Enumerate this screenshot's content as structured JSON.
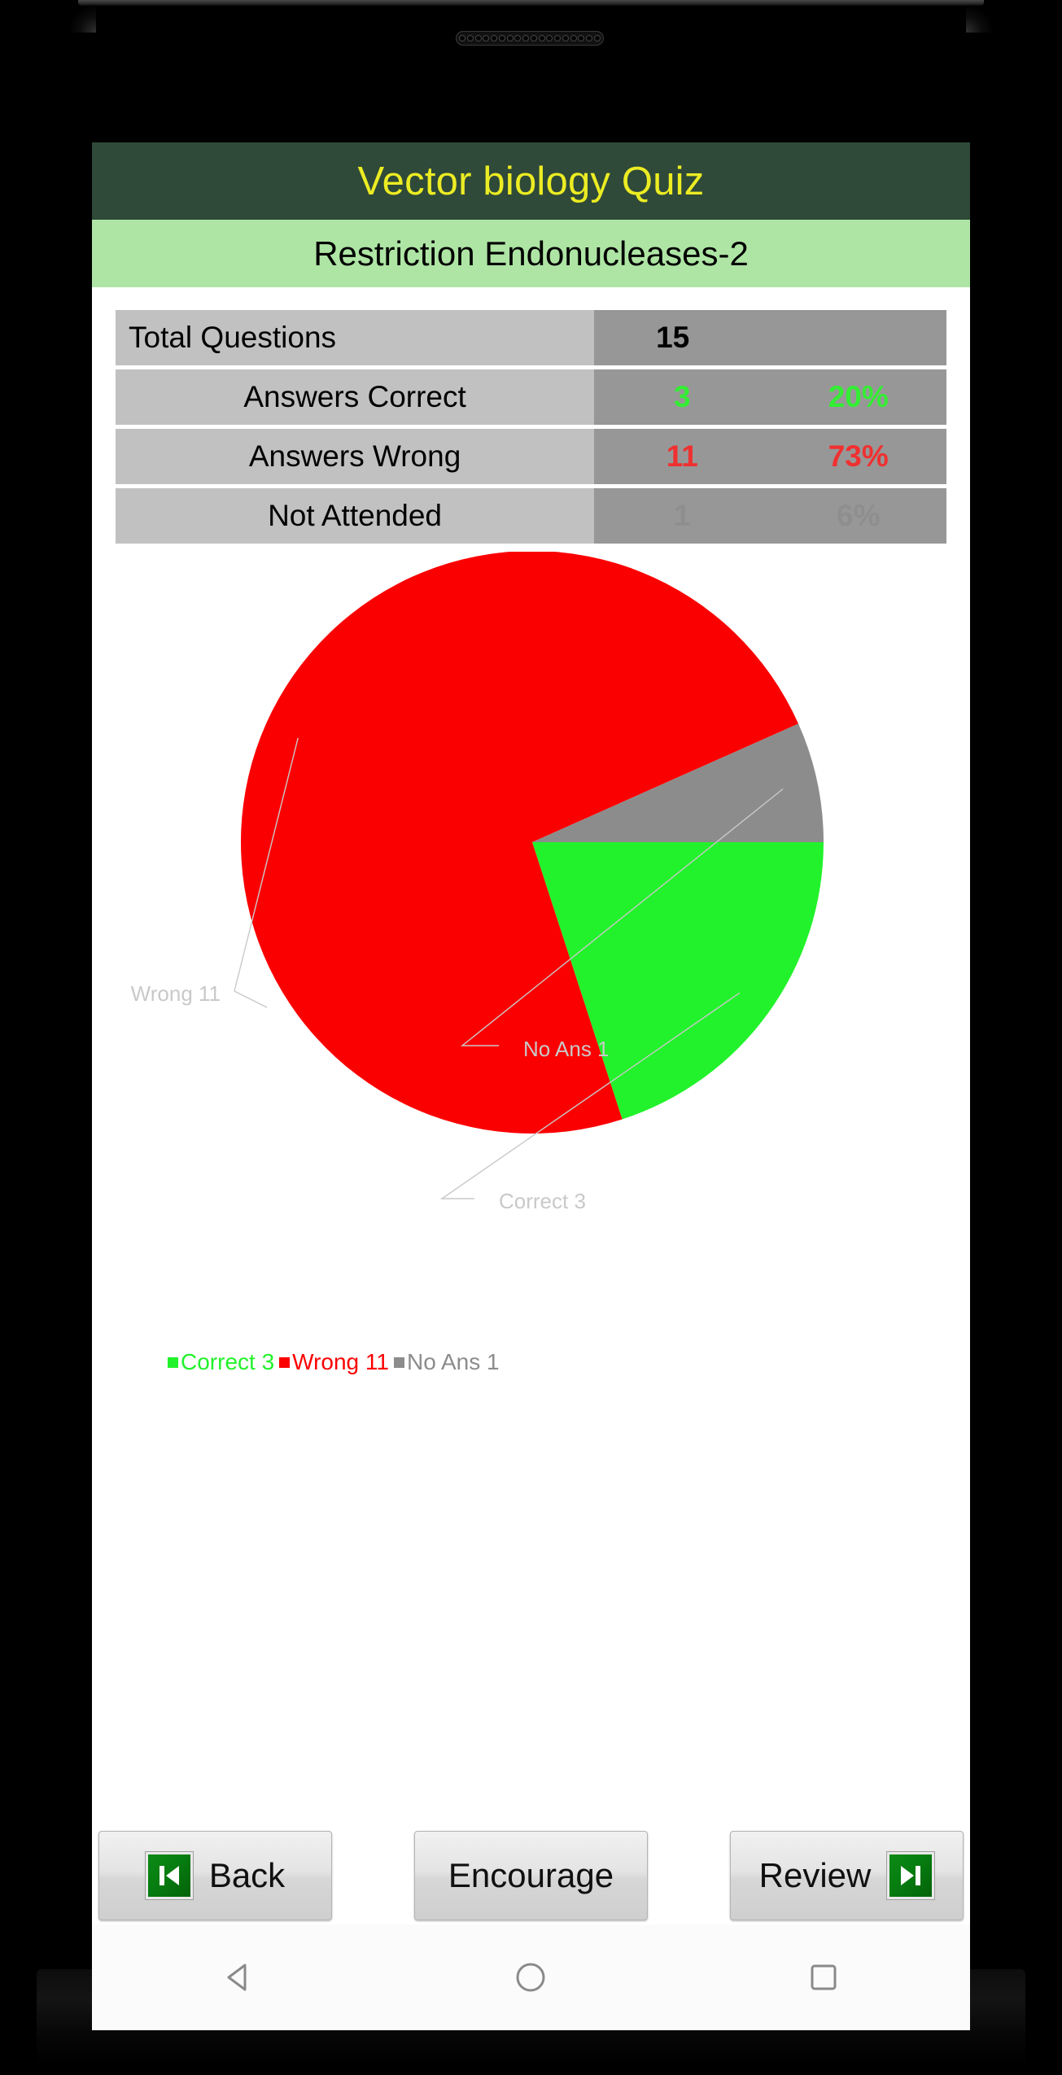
{
  "device": {
    "speaker_icon": "speaker-grille-icon",
    "hole_count": 18
  },
  "app": {
    "title": "Vector biology Quiz",
    "subject": "Restriction Endonucleases-2",
    "title_color": "#ecec23",
    "title_bar_color": "#2f4a38",
    "subject_bar_color": "#aee5a4"
  },
  "stats": {
    "rows": [
      {
        "label": "Total Questions",
        "count": "15",
        "pct": "",
        "color": "#000000",
        "align": "align-left",
        "single": true
      },
      {
        "label": "Answers Correct",
        "count": "3",
        "pct": "20%",
        "color": "#33ee33",
        "align": "align-center",
        "single": false
      },
      {
        "label": "Answers Wrong",
        "count": "11",
        "pct": "73%",
        "color": "#f03030",
        "align": "align-center",
        "single": false
      },
      {
        "label": "Not Attended",
        "count": "1",
        "pct": "6%",
        "color": "#8e8e8e",
        "align": "align-center",
        "single": false
      }
    ],
    "label_cell_color": "#c1c1c1",
    "value_cell_color": "#979797"
  },
  "chart_data": {
    "type": "pie",
    "title": "",
    "categories": [
      "Correct",
      "Wrong",
      "No Ans"
    ],
    "values": [
      3,
      11,
      1
    ],
    "total": 15,
    "percentages": [
      20,
      73,
      6
    ],
    "colors": [
      "#22f22b",
      "#fb0000",
      "#8c8c8c"
    ],
    "slice_labels": [
      "Correct 3",
      "Wrong 11",
      "No Ans 1"
    ],
    "slice_label_color": "#c9c9c9",
    "start_angle_deg": 0,
    "direction": "clockwise",
    "legend_position": "bottom-left",
    "legend": [
      {
        "label": "Correct 3",
        "color": "#22f22b"
      },
      {
        "label": "Wrong 11",
        "color": "#fb0000"
      },
      {
        "label": "No Ans 1",
        "color": "#8c8c8c"
      }
    ],
    "grid": false
  },
  "buttons": [
    {
      "label": "Back",
      "icon": "skip-to-start-icon",
      "icon_side": "left",
      "name": "back-button"
    },
    {
      "label": "Encourage",
      "icon": "",
      "icon_side": "none",
      "name": "encourage-button"
    },
    {
      "label": "Review",
      "icon": "skip-to-end-icon",
      "icon_side": "right",
      "name": "review-button"
    }
  ],
  "android_nav": {
    "back": "android-back-icon",
    "home": "android-home-icon",
    "recents": "android-recents-icon",
    "stroke_color": "#8a8a8a"
  }
}
